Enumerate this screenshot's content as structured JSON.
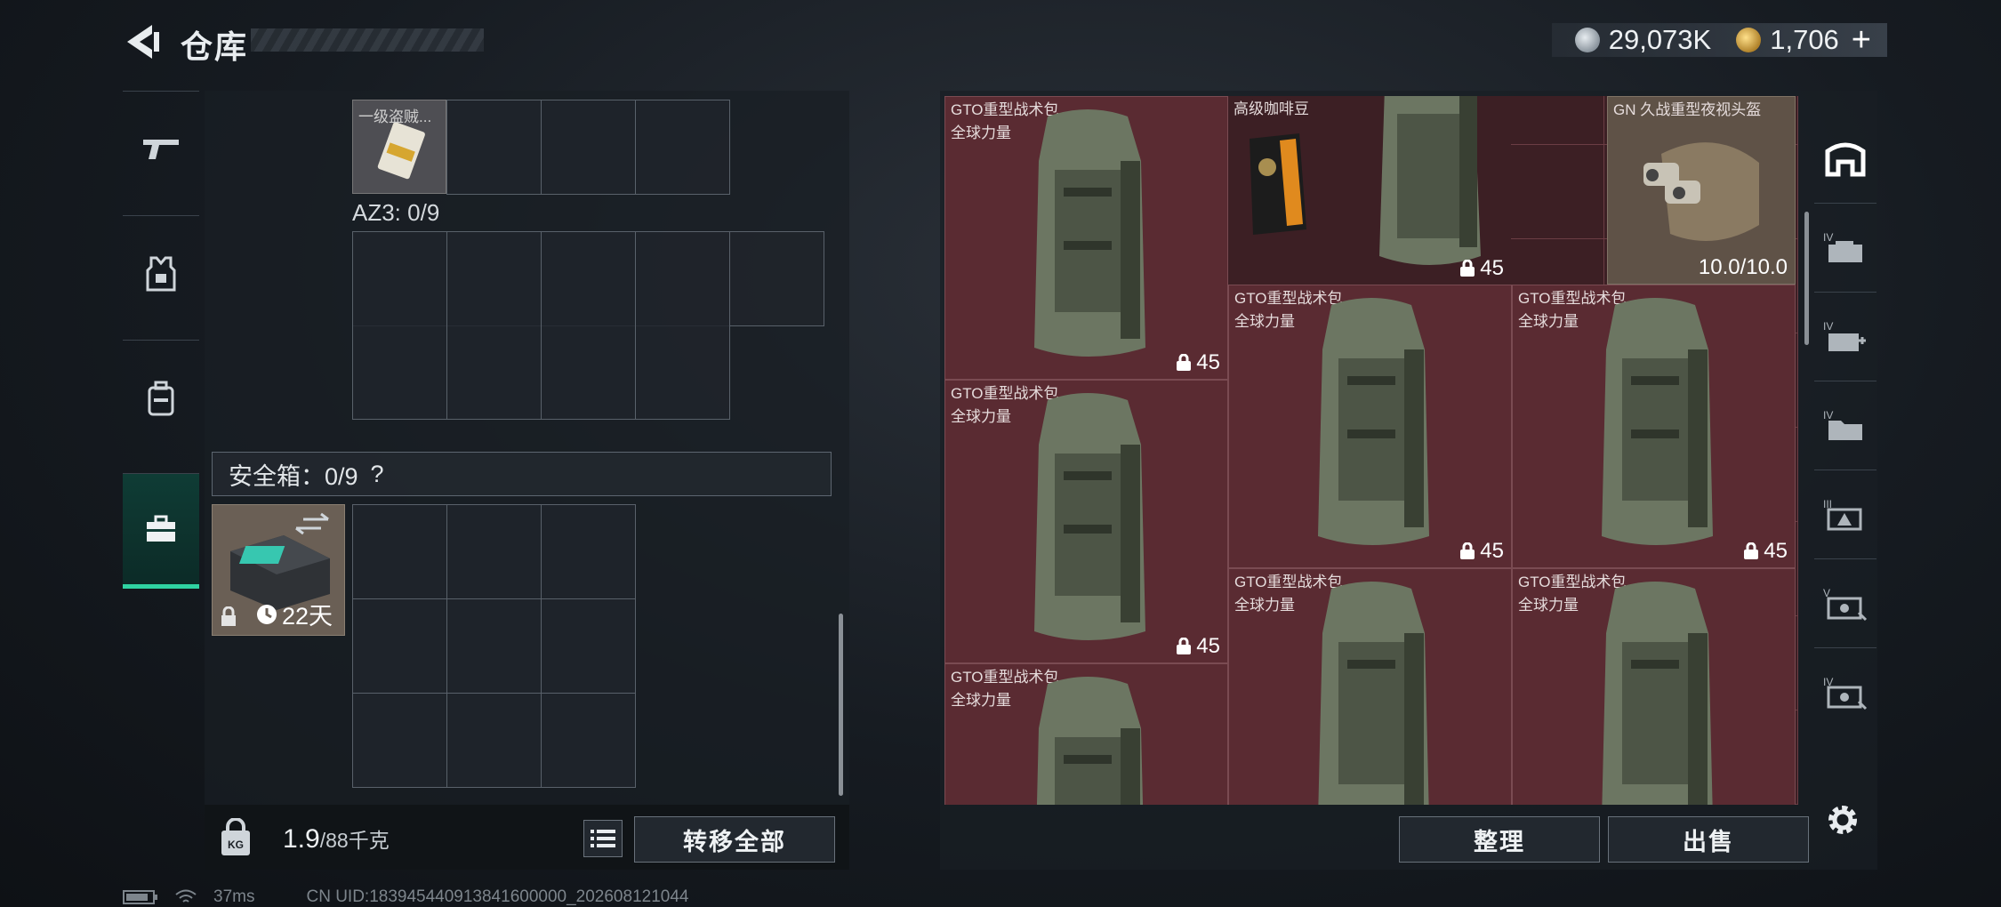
{
  "header": {
    "title": "仓库",
    "currency_silver": "29,073K",
    "currency_gold": "1,706",
    "plus": "+"
  },
  "left_tabs": [
    {
      "name": "weapons",
      "icon": "gun-icon"
    },
    {
      "name": "armor",
      "icon": "vest-icon"
    },
    {
      "name": "backpack",
      "icon": "backpack-icon"
    },
    {
      "name": "safebox",
      "icon": "toolbox-icon",
      "active": true
    }
  ],
  "loadout": {
    "first_item_label": "一级盗贼...",
    "az3_label": "AZ3: 0/9",
    "safebox_label": "安全箱：0/9",
    "safebox_help": "?",
    "safebox_timer": "22天"
  },
  "footer_left": {
    "weight_value": "1.9",
    "weight_unit": "/88千克",
    "transfer_all": "转移全部"
  },
  "stash": {
    "items": [
      {
        "name": "GTO重型战术包",
        "sub": "全球力量",
        "capacity": "45"
      },
      {
        "name": "高级咖啡豆",
        "sub": "",
        "capacity": ""
      },
      {
        "name": "",
        "sub": "",
        "capacity": "45"
      },
      {
        "name": "GN 久战重型夜视头盔",
        "sub": "",
        "capacity": "10.0/10.0"
      },
      {
        "name": "GTO重型战术包",
        "sub": "全球力量",
        "capacity": "45"
      },
      {
        "name": "GTO重型战术包",
        "sub": "全球力量",
        "capacity": "45"
      },
      {
        "name": "GTO重型战术包",
        "sub": "全球力量",
        "capacity": "45"
      },
      {
        "name": "GTO重型战术包",
        "sub": "全球力量",
        "capacity": ""
      },
      {
        "name": "GTO重型战术包",
        "sub": "全球力量",
        "capacity": ""
      },
      {
        "name": "GTO重型战术包",
        "sub": "全球力量",
        "capacity": ""
      }
    ],
    "sort_label": "整理",
    "sell_label": "出售"
  },
  "right_tabs": [
    "all",
    "IV",
    "IV",
    "IV",
    "III",
    "V",
    "IV"
  ],
  "status_bar": {
    "ping": "37ms",
    "uid": "CN UID:183945440913841600000_202608121044"
  },
  "colors": {
    "accent": "#2fd3a2",
    "stash_bg": "#3c1f24"
  }
}
